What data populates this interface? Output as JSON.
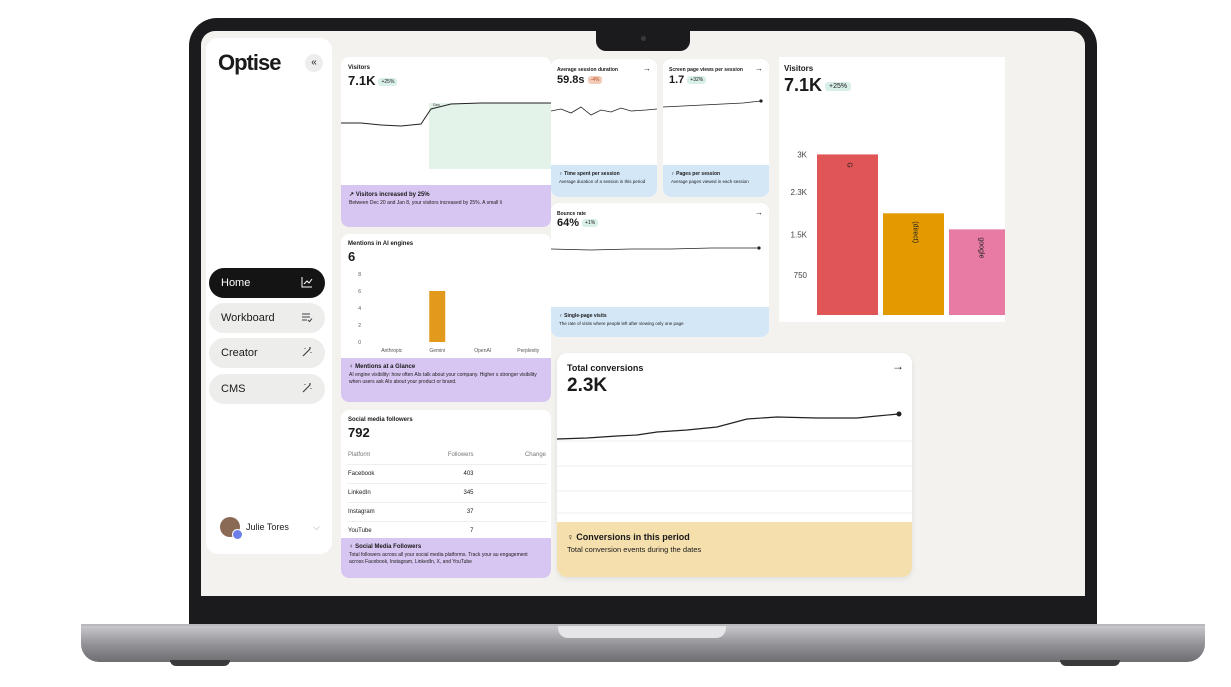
{
  "brand": {
    "name": "Optise",
    "collapse_icon": "«"
  },
  "nav": [
    {
      "label": "Home",
      "icon": "chart-line-icon",
      "active": true
    },
    {
      "label": "Workboard",
      "icon": "list-check-icon",
      "active": false
    },
    {
      "label": "Creator",
      "icon": "magic-wand-icon",
      "active": false
    },
    {
      "label": "CMS",
      "icon": "magic-wand-icon",
      "active": false
    }
  ],
  "user": {
    "name": "Julie Tores"
  },
  "visitors_small": {
    "label": "Visitors",
    "value": "7.1K",
    "change": "+25%",
    "marker": "Dec",
    "insight_title": "Visitors increased by 25%",
    "insight_text": "Between Dec 20 and Jan 8, your visitors increased by 25%. A small li"
  },
  "session_duration": {
    "label": "Average session duration",
    "value": "59.8s",
    "change": "-4%",
    "insight_title": "Time spent per session",
    "insight_text": "Average duration of a session in this period"
  },
  "pages_per_session": {
    "label": "Screen page views per session",
    "value": "1.7",
    "change": "+32%",
    "insight_title": "Pages per session",
    "insight_text": "Average pages viewed in each session"
  },
  "bounce_rate": {
    "label": "Bounce rate",
    "value": "64%",
    "change": "+1%",
    "insight_title": "Single-page visits",
    "insight_text": "The rate of visits where people left after viewing only one page"
  },
  "mentions": {
    "label": "Mentions in AI engines",
    "value": "6",
    "insight_title": "Mentions at a Glance",
    "insight_text": "AI engine visibility: how often AIs talk about your company. Higher s stronger visibility when users ask AIs about your product or brand."
  },
  "social": {
    "label": "Social media followers",
    "value": "792",
    "headers": [
      "Platform",
      "Followers",
      "Change"
    ],
    "rows": [
      {
        "platform": "Facebook",
        "followers": "403"
      },
      {
        "platform": "LinkedIn",
        "followers": "345"
      },
      {
        "platform": "Instagram",
        "followers": "37"
      },
      {
        "platform": "YouTube",
        "followers": "7"
      }
    ],
    "insight_title": "Social Media Followers",
    "insight_text": "Total followers across all your social media platforms. Track your au engagement across Facebook, Instagram, LinkedIn, X, and YouTube"
  },
  "conversions": {
    "label": "Total conversions",
    "value": "2.3K",
    "insight_title": "Conversions in this period",
    "insight_text": "Total conversion events during the dates"
  },
  "visitors_large": {
    "label": "Visitors",
    "value": "7.1K",
    "change": "+25%"
  },
  "chart_data": [
    {
      "type": "bar",
      "title": "Mentions in AI engines",
      "categories": [
        "Anthropic",
        "Gemini",
        "OpenAI",
        "Perplexity"
      ],
      "values": [
        0,
        6,
        0,
        0
      ],
      "ylim": [
        0,
        8
      ],
      "yticks": [
        "0",
        "2",
        "4",
        "6",
        "8"
      ],
      "color": "#e39a1c"
    },
    {
      "type": "bar",
      "title": "Visitors",
      "categories": [
        "G",
        "(direct)",
        "google"
      ],
      "values": [
        3000,
        1900,
        1600
      ],
      "yticks": [
        "750",
        "1.5K",
        "2.3K",
        "3K"
      ],
      "ylim": [
        0,
        3400
      ],
      "colors": [
        "#e05555",
        "#e39a00",
        "#e87ba4"
      ]
    }
  ]
}
